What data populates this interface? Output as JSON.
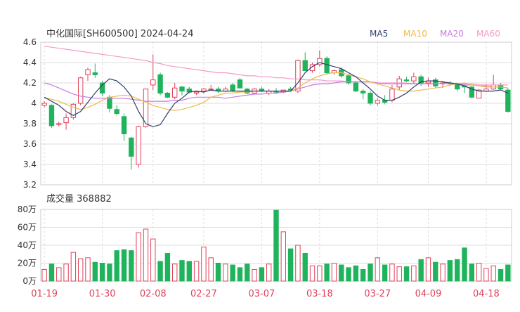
{
  "header": {
    "title": "中化国际[SH600500] 2024-04-24",
    "legend": [
      {
        "label": "MA5",
        "color": "#2f3e6b"
      },
      {
        "label": "MA10",
        "color": "#f0b84a"
      },
      {
        "label": "MA20",
        "color": "#c77be0"
      },
      {
        "label": "MA60",
        "color": "#f59ac8"
      }
    ]
  },
  "volume_title": "成交量 368882",
  "colors": {
    "up": "#e0435a",
    "down": "#1fb35c",
    "grid": "#dddddd",
    "axis_text": "#333333",
    "date_text": "#e0435a"
  },
  "chart_data": [
    {
      "type": "candlestick",
      "title": "中化国际[SH600500] 2024-04-24",
      "ylim": [
        3.2,
        4.6
      ],
      "y_ticks": [
        "4.6",
        "4.4",
        "4.2",
        "4",
        "3.8",
        "3.6",
        "3.4",
        "3.2"
      ],
      "x_tick_labels": [
        "01-19",
        "01-30",
        "02-08",
        "02-27",
        "03-07",
        "03-18",
        "03-27",
        "04-09",
        "04-18"
      ],
      "ohlc": [
        [
          3.98,
          4.02,
          3.96,
          4.0
        ],
        [
          3.98,
          3.99,
          3.76,
          3.78
        ],
        [
          3.8,
          3.82,
          3.77,
          3.8
        ],
        [
          3.81,
          3.9,
          3.74,
          3.86
        ],
        [
          3.86,
          4.0,
          3.84,
          3.99
        ],
        [
          4.0,
          4.26,
          3.98,
          4.25
        ],
        [
          4.28,
          4.35,
          4.22,
          4.33
        ],
        [
          4.3,
          4.39,
          4.25,
          4.28
        ],
        [
          4.2,
          4.22,
          4.07,
          4.1
        ],
        [
          4.06,
          4.08,
          3.91,
          3.95
        ],
        [
          3.94,
          3.98,
          3.88,
          3.9
        ],
        [
          3.87,
          3.9,
          3.63,
          3.7
        ],
        [
          3.66,
          3.67,
          3.35,
          3.48
        ],
        [
          3.4,
          3.78,
          3.37,
          3.77
        ],
        [
          3.77,
          4.14,
          3.76,
          4.14
        ],
        [
          4.18,
          4.48,
          4.13,
          4.23
        ],
        [
          4.28,
          4.3,
          4.08,
          4.1
        ],
        [
          4.1,
          4.11,
          4.05,
          4.06
        ],
        [
          4.06,
          4.2,
          4.04,
          4.15
        ],
        [
          4.16,
          4.17,
          4.08,
          4.12
        ],
        [
          4.14,
          4.16,
          4.1,
          4.11
        ],
        [
          4.1,
          4.12,
          4.08,
          4.11
        ],
        [
          4.12,
          4.15,
          4.1,
          4.14
        ],
        [
          4.14,
          4.18,
          4.12,
          4.14
        ],
        [
          4.14,
          4.16,
          4.1,
          4.12
        ],
        [
          4.12,
          4.16,
          4.11,
          4.14
        ],
        [
          4.18,
          4.2,
          4.11,
          4.12
        ],
        [
          4.23,
          4.25,
          4.15,
          4.15
        ],
        [
          4.14,
          4.15,
          4.09,
          4.1
        ],
        [
          4.1,
          4.15,
          4.09,
          4.14
        ],
        [
          4.14,
          4.16,
          4.11,
          4.12
        ],
        [
          4.1,
          4.14,
          4.08,
          4.12
        ],
        [
          4.12,
          4.15,
          4.09,
          4.11
        ],
        [
          4.11,
          4.13,
          4.1,
          4.13
        ],
        [
          4.14,
          4.16,
          4.12,
          4.13
        ],
        [
          4.12,
          4.43,
          4.1,
          4.42
        ],
        [
          4.42,
          4.5,
          4.35,
          4.32
        ],
        [
          4.32,
          4.4,
          4.3,
          4.38
        ],
        [
          4.38,
          4.52,
          4.36,
          4.44
        ],
        [
          4.44,
          4.46,
          4.28,
          4.3
        ],
        [
          4.3,
          4.33,
          4.28,
          4.32
        ],
        [
          4.33,
          4.35,
          4.25,
          4.27
        ],
        [
          4.27,
          4.29,
          4.18,
          4.2
        ],
        [
          4.2,
          4.22,
          4.11,
          4.12
        ],
        [
          4.12,
          4.14,
          4.04,
          4.1
        ],
        [
          4.1,
          4.12,
          3.98,
          4.0
        ],
        [
          4.0,
          4.05,
          3.98,
          4.03
        ],
        [
          4.03,
          4.08,
          3.99,
          4.01
        ],
        [
          4.03,
          4.18,
          4.01,
          4.14
        ],
        [
          4.16,
          4.27,
          4.13,
          4.24
        ],
        [
          4.23,
          4.26,
          4.21,
          4.22
        ],
        [
          4.22,
          4.3,
          4.19,
          4.26
        ],
        [
          4.26,
          4.28,
          4.17,
          4.2
        ],
        [
          4.2,
          4.25,
          4.16,
          4.22
        ],
        [
          4.23,
          4.25,
          4.15,
          4.17
        ],
        [
          4.19,
          4.22,
          4.15,
          4.2
        ],
        [
          4.2,
          4.22,
          4.17,
          4.19
        ],
        [
          4.19,
          4.2,
          4.12,
          4.14
        ],
        [
          4.17,
          4.2,
          4.1,
          4.16
        ],
        [
          4.16,
          4.17,
          4.05,
          4.06
        ],
        [
          4.05,
          4.14,
          4.05,
          4.13
        ],
        [
          4.12,
          4.19,
          4.11,
          4.14
        ],
        [
          4.14,
          4.28,
          4.13,
          4.18
        ],
        [
          4.18,
          4.2,
          4.13,
          4.14
        ],
        [
          4.13,
          4.15,
          3.91,
          3.92
        ]
      ],
      "ma5": [
        4.06,
        4.02,
        3.98,
        3.92,
        3.88,
        3.92,
        4.01,
        4.1,
        4.18,
        4.24,
        4.22,
        4.16,
        4.07,
        3.92,
        3.8,
        3.77,
        3.79,
        3.9,
        4.0,
        4.05,
        4.11,
        4.12,
        4.11,
        4.13,
        4.12,
        4.12,
        4.12,
        4.12,
        4.12,
        4.12,
        4.12,
        4.12,
        4.12,
        4.12,
        4.12,
        4.2,
        4.3,
        4.36,
        4.4,
        4.38,
        4.36,
        4.34,
        4.3,
        4.26,
        4.2,
        4.14,
        4.07,
        4.03,
        4.03,
        4.06,
        4.1,
        4.16,
        4.21,
        4.22,
        4.22,
        4.21,
        4.2,
        4.19,
        4.17,
        4.14,
        4.12,
        4.12,
        4.12,
        4.13,
        4.1
      ],
      "ma10": [
        4.05,
        4.04,
        4.02,
        3.99,
        3.96,
        3.94,
        3.96,
        3.99,
        4.03,
        4.06,
        4.07,
        4.08,
        4.07,
        4.04,
        4.01,
        3.98,
        3.96,
        3.94,
        3.93,
        3.94,
        3.96,
        3.98,
        4.01,
        4.06,
        4.08,
        4.1,
        4.1,
        4.11,
        4.11,
        4.12,
        4.12,
        4.12,
        4.12,
        4.12,
        4.12,
        4.15,
        4.2,
        4.24,
        4.27,
        4.29,
        4.3,
        4.3,
        4.28,
        4.26,
        4.24,
        4.21,
        4.19,
        4.17,
        4.15,
        4.13,
        4.12,
        4.12,
        4.13,
        4.14,
        4.15,
        4.16,
        4.18,
        4.19,
        4.2,
        4.18,
        4.17,
        4.16,
        4.16,
        4.16,
        4.15
      ],
      "ma20": [
        4.2,
        4.18,
        4.15,
        4.12,
        4.09,
        4.07,
        4.06,
        4.05,
        4.05,
        4.05,
        4.05,
        4.05,
        4.04,
        4.03,
        4.02,
        4.02,
        4.02,
        4.02,
        4.03,
        4.03,
        4.05,
        4.06,
        4.06,
        4.06,
        4.06,
        4.05,
        4.06,
        4.07,
        4.08,
        4.09,
        4.09,
        4.1,
        4.1,
        4.11,
        4.12,
        4.14,
        4.16,
        4.18,
        4.19,
        4.19,
        4.2,
        4.21,
        4.21,
        4.21,
        4.21,
        4.21,
        4.2,
        4.19,
        4.19,
        4.19,
        4.19,
        4.19,
        4.19,
        4.19,
        4.19,
        4.19,
        4.19,
        4.19,
        4.18,
        4.18,
        4.17,
        4.17,
        4.16,
        4.16,
        4.15
      ],
      "ma60": [
        4.56,
        4.55,
        4.54,
        4.53,
        4.52,
        4.51,
        4.5,
        4.49,
        4.48,
        4.47,
        4.46,
        4.45,
        4.44,
        4.43,
        4.42,
        4.4,
        4.39,
        4.37,
        4.36,
        4.35,
        4.34,
        4.33,
        4.32,
        4.31,
        4.3,
        4.3,
        4.29,
        4.28,
        4.27,
        4.27,
        4.26,
        4.26,
        4.25,
        4.25,
        4.24,
        4.24,
        4.23,
        4.23,
        4.23,
        4.22,
        4.22,
        4.22,
        4.21,
        4.21,
        4.21,
        4.21,
        4.2,
        4.2,
        4.2,
        4.2,
        4.2,
        4.19,
        4.19,
        4.19,
        4.19,
        4.19,
        4.19,
        4.19,
        4.19,
        4.19,
        4.18,
        4.18,
        4.18,
        4.18,
        4.18
      ]
    },
    {
      "type": "bar",
      "title": "成交量 368882",
      "ylim": [
        0,
        80
      ],
      "y_ticks": [
        "80万",
        "60万",
        "40万",
        "20万",
        "0万"
      ],
      "x_tick_labels": [
        "01-19",
        "01-30",
        "02-08",
        "02-27",
        "03-07",
        "03-18",
        "03-27",
        "04-09",
        "04-18"
      ],
      "values": [
        13,
        19,
        15,
        19,
        32,
        25,
        26,
        21,
        20,
        19,
        34,
        35,
        34,
        54,
        58,
        47,
        22,
        31,
        19,
        23,
        22,
        22,
        38,
        26,
        20,
        19,
        18,
        15,
        19,
        13,
        15,
        19,
        79,
        55,
        36,
        40,
        31,
        17,
        17,
        19,
        20,
        18,
        15,
        17,
        13,
        19,
        26,
        18,
        19,
        16,
        16,
        17,
        24,
        26,
        21,
        19,
        23,
        24,
        37,
        19,
        20,
        14,
        17,
        13,
        18
      ],
      "highlight_value": 368882
    }
  ]
}
